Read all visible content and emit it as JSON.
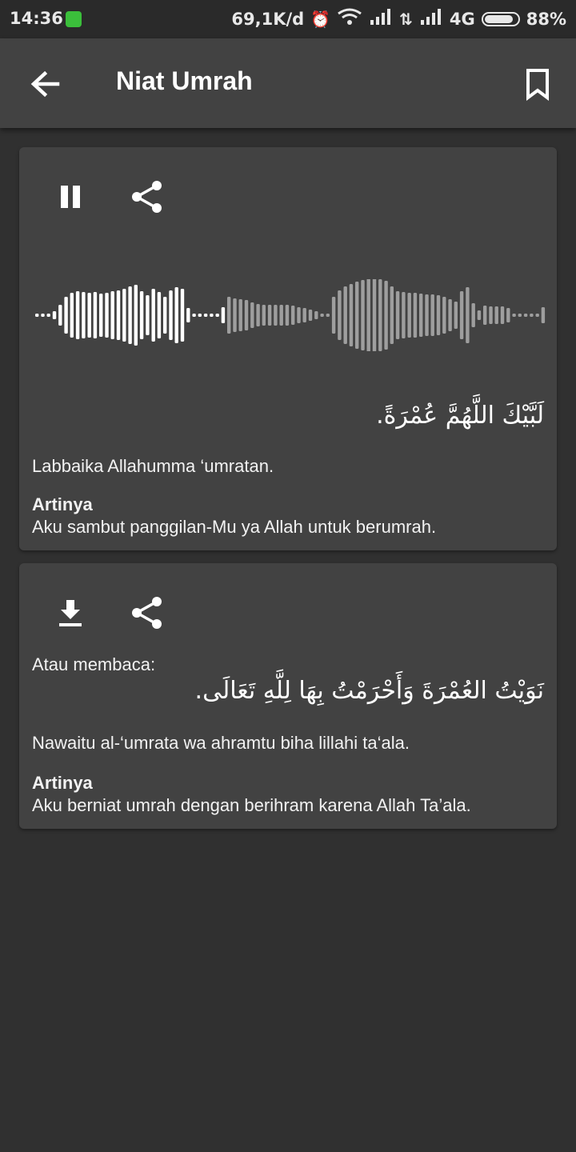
{
  "status_bar": {
    "time": "14:36",
    "network_speed": "69,1K/d",
    "network_type": "4G",
    "battery": "88%"
  },
  "app_bar": {
    "title": "Niat Umrah",
    "back_icon": "arrow-back-icon",
    "bookmark_icon": "bookmark-icon"
  },
  "cards": [
    {
      "controls": [
        "pause-icon",
        "share-icon"
      ],
      "arabic": "لَبَّيْكَ اللَّهُمَّ عُمْرَةً.",
      "latin": "Labbaika Allahumma ‘umratan.",
      "meaning_label": "Artinya",
      "meaning": "Aku sambut panggilan-Mu ya Allah untuk berumrah."
    },
    {
      "controls": [
        "download-icon",
        "share-icon"
      ],
      "intro": "Atau membaca:",
      "arabic": "نَوَيْتُ العُمْرَةَ وَأَحْرَمْتُ بِهَا لِلَّهِ تَعَالَى.",
      "latin": "Nawaitu al-‘umrata wa ahramtu biha lillahi ta‘ala.",
      "meaning_label": "Artinya",
      "meaning": "Aku berniat umrah dengan berihram karena Allah Ta’ala."
    }
  ],
  "colors": {
    "background": "#303030",
    "surface": "#424242",
    "waveform_played": "#ffffff",
    "waveform_unplayed": "#9e9e9e"
  }
}
